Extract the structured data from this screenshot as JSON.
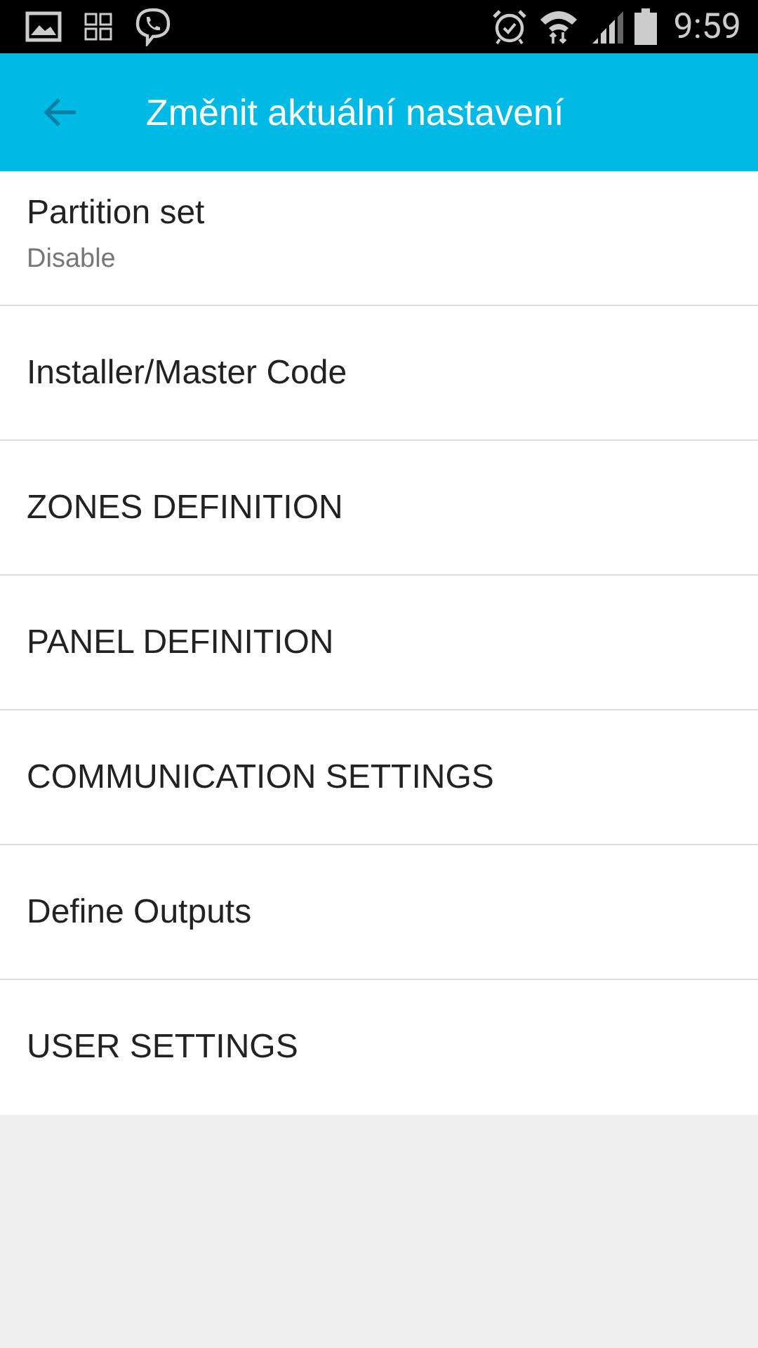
{
  "status_bar": {
    "time": "9:59"
  },
  "app_bar": {
    "title": "Změnit aktuální nastavení"
  },
  "items": [
    {
      "title": "Partition set",
      "summary": "Disable"
    },
    {
      "title": "Installer/Master Code"
    },
    {
      "title": "ZONES DEFINITION"
    },
    {
      "title": "PANEL DEFINITION"
    },
    {
      "title": "COMMUNICATION SETTINGS"
    },
    {
      "title": "Define Outputs"
    },
    {
      "title": "USER SETTINGS"
    }
  ]
}
